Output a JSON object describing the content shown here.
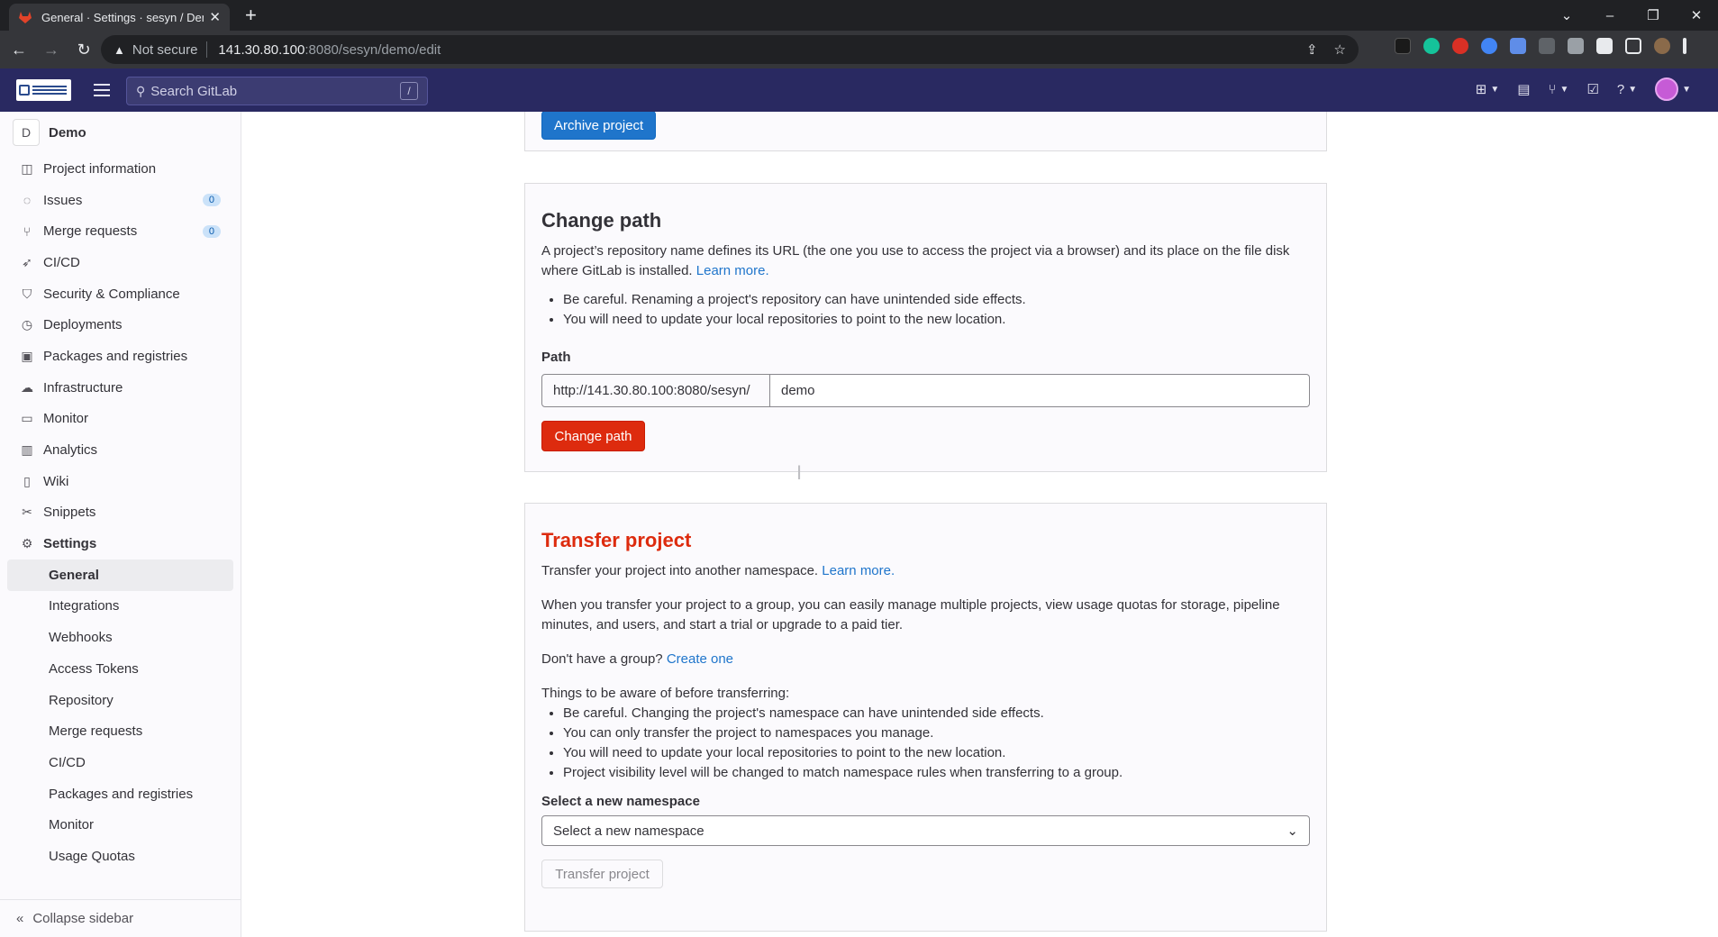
{
  "browser": {
    "tab_title": "General · Settings · sesyn / Demo · G",
    "new_tab": "+",
    "not_secure": "Not secure",
    "url_host": "141.30.80.100",
    "url_rest": ":8080/sesyn/demo/edit"
  },
  "header": {
    "search_placeholder": "Search GitLab",
    "search_shortcut": "/"
  },
  "project": {
    "avatar_letter": "D",
    "name": "Demo"
  },
  "sidebar": {
    "items": [
      {
        "label": "Project information",
        "icon": "project-icon"
      },
      {
        "label": "Issues",
        "icon": "issues-icon",
        "count": "0"
      },
      {
        "label": "Merge requests",
        "icon": "merge-request-icon",
        "count": "0"
      },
      {
        "label": "CI/CD",
        "icon": "rocket-icon"
      },
      {
        "label": "Security & Compliance",
        "icon": "shield-icon"
      },
      {
        "label": "Deployments",
        "icon": "deployments-icon"
      },
      {
        "label": "Packages and registries",
        "icon": "package-icon"
      },
      {
        "label": "Infrastructure",
        "icon": "cloud-icon"
      },
      {
        "label": "Monitor",
        "icon": "monitor-icon"
      },
      {
        "label": "Analytics",
        "icon": "chart-icon"
      },
      {
        "label": "Wiki",
        "icon": "book-icon"
      },
      {
        "label": "Snippets",
        "icon": "snippet-icon"
      },
      {
        "label": "Settings",
        "icon": "gear-icon"
      }
    ],
    "settings_sub": [
      {
        "label": "General",
        "active": true
      },
      {
        "label": "Integrations"
      },
      {
        "label": "Webhooks"
      },
      {
        "label": "Access Tokens"
      },
      {
        "label": "Repository"
      },
      {
        "label": "Merge requests"
      },
      {
        "label": "CI/CD"
      },
      {
        "label": "Packages and registries"
      },
      {
        "label": "Monitor"
      },
      {
        "label": "Usage Quotas"
      }
    ],
    "collapse_label": "Collapse sidebar"
  },
  "archive": {
    "button": "Archive project"
  },
  "change_path": {
    "title": "Change path",
    "description": "A project’s repository name defines its URL (the one you use to access the project via a browser) and its place on the file disk where GitLab is installed.",
    "learn_more": "Learn more.",
    "bullets": [
      "Be careful. Renaming a project's repository can have unintended side effects.",
      "You will need to update your local repositories to point to the new location."
    ],
    "path_label": "Path",
    "path_prefix": "http://141.30.80.100:8080/sesyn/",
    "path_value": "demo",
    "button": "Change path"
  },
  "transfer": {
    "title": "Transfer project",
    "intro": "Transfer your project into another namespace.",
    "learn_more": "Learn more.",
    "group_text": "When you transfer your project to a group, you can easily manage multiple projects, view usage quotas for storage, pipeline minutes, and users, and start a trial or upgrade to a paid tier.",
    "no_group": "Don't have a group?",
    "create_one": "Create one",
    "aware_heading": "Things to be aware of before transferring:",
    "bullets": [
      "Be careful. Changing the project's namespace can have unintended side effects.",
      "You can only transfer the project to namespaces you manage.",
      "You will need to update your local repositories to point to the new location.",
      "Project visibility level will be changed to match namespace rules when transferring to a group."
    ],
    "namespace_label": "Select a new namespace",
    "namespace_placeholder": "Select a new namespace",
    "button": "Transfer project"
  }
}
